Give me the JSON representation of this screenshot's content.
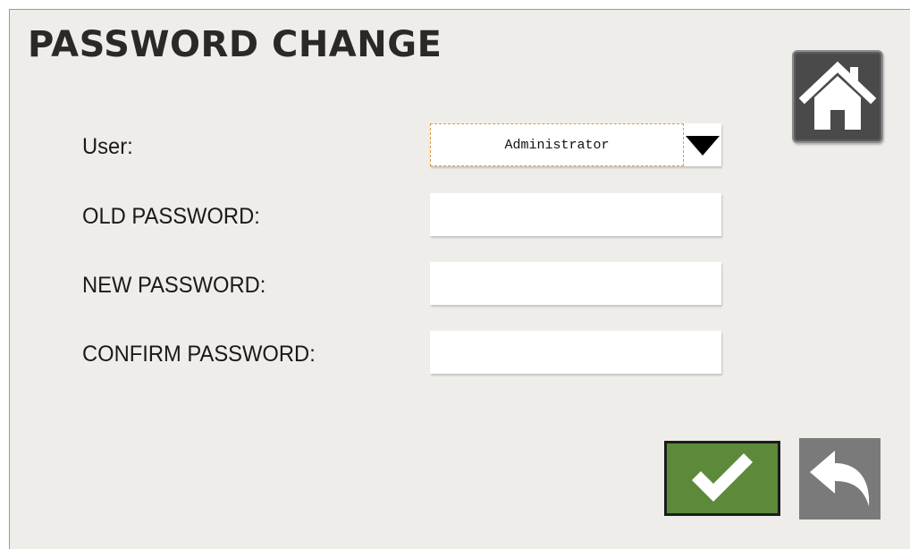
{
  "header": {
    "title": "PASSWORD CHANGE",
    "home_icon": "home-icon"
  },
  "form": {
    "user": {
      "label": "User:",
      "selected": "Administrator"
    },
    "old_password": {
      "label": "OLD PASSWORD:",
      "value": ""
    },
    "new_password": {
      "label": "NEW PASSWORD:",
      "value": ""
    },
    "confirm_password": {
      "label": "CONFIRM PASSWORD:",
      "value": ""
    }
  },
  "actions": {
    "confirm_icon": "checkmark-icon",
    "back_icon": "back-arrow-icon"
  },
  "colors": {
    "background": "#efedea",
    "confirm_green": "#5c8a3a",
    "back_gray": "#7a7a7a",
    "home_dark": "#4a4a4a",
    "selection_outline": "#e39a3a"
  }
}
